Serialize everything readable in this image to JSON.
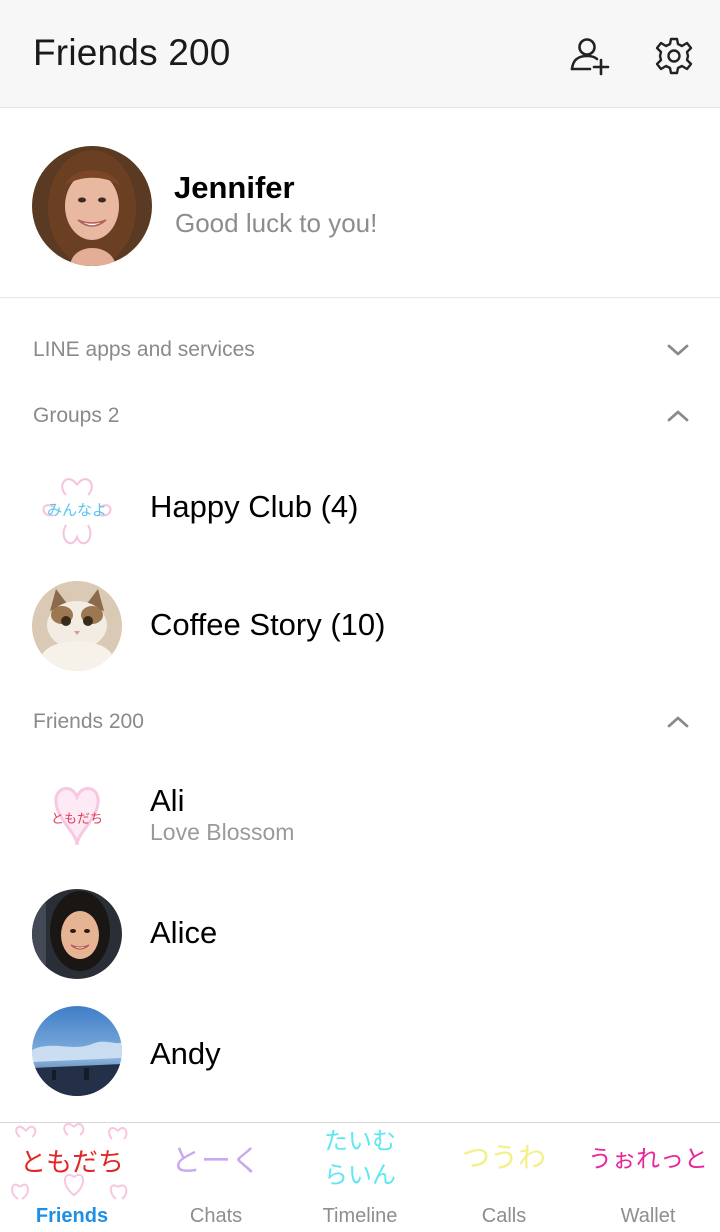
{
  "header": {
    "title": "Friends 200",
    "add_friend_icon": "add-person-icon",
    "settings_icon": "gear-icon"
  },
  "profile": {
    "name": "Jennifer",
    "status": "Good luck to you!"
  },
  "sections": {
    "services": {
      "label": "LINE apps and services",
      "state": "collapsed"
    },
    "groups": {
      "label": "Groups 2",
      "state": "expanded"
    },
    "friends": {
      "label": "Friends 200",
      "state": "expanded"
    }
  },
  "groups": [
    {
      "name": "Happy Club (4)",
      "avatar_text": "みんなよ"
    },
    {
      "name": "Coffee Story (10)"
    }
  ],
  "friends": [
    {
      "name": "Ali",
      "status": "Love Blossom",
      "avatar_text": "ともだち"
    },
    {
      "name": "Alice"
    },
    {
      "name": "Andy"
    }
  ],
  "tabs": [
    {
      "label": "Friends",
      "art": "ともだち",
      "active": true
    },
    {
      "label": "Chats",
      "art": "とーく",
      "active": false
    },
    {
      "label": "Timeline",
      "art_line1": "たいむ",
      "art_line2": "らいん",
      "active": false
    },
    {
      "label": "Calls",
      "art": "つうわ",
      "active": false
    },
    {
      "label": "Wallet",
      "art": "うぉれっと",
      "active": false
    }
  ],
  "colors": {
    "accent": "#1e8fe6",
    "header_bg": "#f7f7f7",
    "tab_friends_art": "#e02828",
    "tab_chats_art": "#c9a8f0",
    "tab_timeline_art": "#5ee8f0",
    "tab_calls_art": "#f3f08a",
    "tab_wallet_art": "#e8289a"
  }
}
